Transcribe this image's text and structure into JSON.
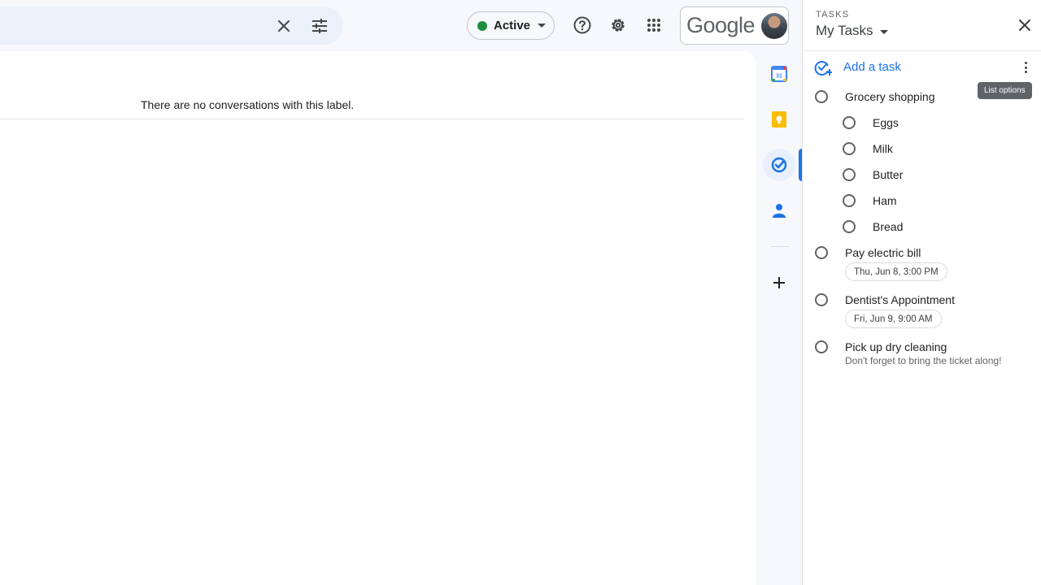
{
  "header": {
    "status_label": "Active",
    "google_wordmark": "Google"
  },
  "main": {
    "empty_message": "There are no conversations with this label."
  },
  "tasks": {
    "eyebrow": "TASKS",
    "list_name": "My Tasks",
    "add_task_label": "Add a task",
    "list_options_tooltip": "List options",
    "items": [
      {
        "title": "Grocery shopping",
        "subtasks": [
          "Eggs",
          "Milk",
          "Butter",
          "Ham",
          "Bread"
        ]
      },
      {
        "title": "Pay electric bill",
        "date": "Thu, Jun 8, 3:00 PM"
      },
      {
        "title": "Dentist's Appointment",
        "date": "Fri, Jun 9, 9:00 AM"
      },
      {
        "title": "Pick up dry cleaning",
        "note": "Don't forget to bring the ticket along!"
      }
    ]
  },
  "colors": {
    "accent": "#1a73e8",
    "status_green": "#1e8e3e",
    "keep_yellow": "#fbbc04"
  }
}
